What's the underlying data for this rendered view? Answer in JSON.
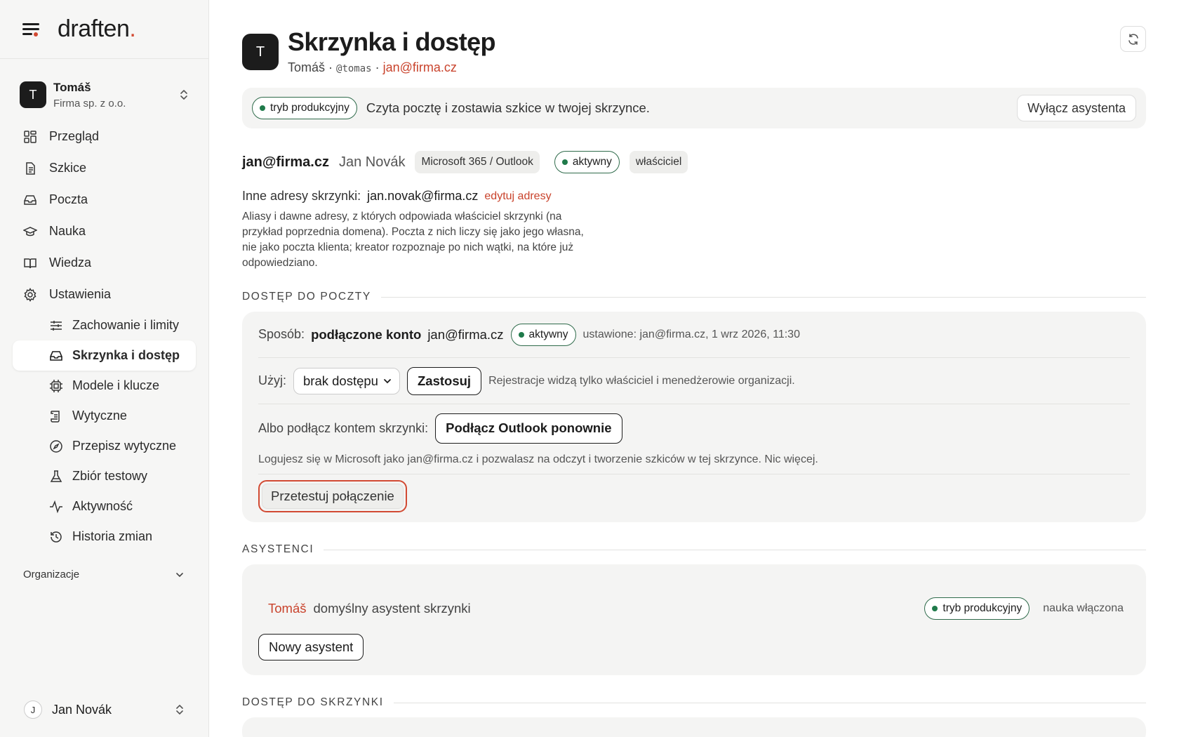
{
  "brand": {
    "logo_text": "draften",
    "logo_accent": "."
  },
  "org_switcher": {
    "initial": "T",
    "name": "Tomáš",
    "company": "Firma sp. z o.o."
  },
  "nav": {
    "items": [
      {
        "label": "Przegląd",
        "icon": "grid-icon"
      },
      {
        "label": "Szkice",
        "icon": "document-icon"
      },
      {
        "label": "Poczta",
        "icon": "inbox-icon"
      },
      {
        "label": "Nauka",
        "icon": "graduation-cap-icon"
      },
      {
        "label": "Wiedza",
        "icon": "book-icon"
      },
      {
        "label": "Ustawienia",
        "icon": "gear-icon"
      }
    ],
    "settings_sub": [
      {
        "label": "Zachowanie i limity",
        "icon": "sliders-icon"
      },
      {
        "label": "Skrzynka i dostęp",
        "icon": "inbox-icon",
        "active": true
      },
      {
        "label": "Modele i klucze",
        "icon": "chip-icon"
      },
      {
        "label": "Wytyczne",
        "icon": "scroll-icon"
      },
      {
        "label": "Przepisz wytyczne",
        "icon": "compass-icon"
      },
      {
        "label": "Zbiór testowy",
        "icon": "flask-icon"
      },
      {
        "label": "Aktywność",
        "icon": "activity-icon"
      },
      {
        "label": "Historia zmian",
        "icon": "history-icon"
      }
    ]
  },
  "org_section": {
    "label": "Organizacje"
  },
  "user": {
    "initial": "J",
    "name": "Jan Novák"
  },
  "header": {
    "initial": "T",
    "title": "Skrzynka i dostęp",
    "owner": "Tomáš",
    "sep1": " · ",
    "handle": "@tomas",
    "sep2": " · ",
    "email": "jan@firma.cz"
  },
  "banner": {
    "mode": "tryb produkcyjny",
    "description": "Czyta pocztę i zostawia szkice w twojej skrzynce.",
    "disable_button": "Wyłącz asystenta"
  },
  "account": {
    "email": "jan@firma.cz",
    "name": "Jan Novák",
    "provider": "Microsoft 365 / Outlook",
    "status": "aktywny",
    "role": "właściciel",
    "alias_label": "Inne adresy skrzynki:",
    "alias_value": "jan.novak@firma.cz",
    "alias_edit": "edytuj adresy",
    "alias_note": "Aliasy i dawne adresy, z których odpowiada właściciel skrzynki (na przykład poprzednia domena). Poczta z nich liczy się jako jego własna, nie jako poczta klienta; kreator rozpoznaje po nich wątki, na które już odpowiedziano."
  },
  "mail_access": {
    "section_title": "DOSTĘP DO POCZTY",
    "method_label": "Sposób:",
    "method_value": "podłączone konto",
    "method_email": "jan@firma.cz",
    "method_status": "aktywny",
    "set_info": "ustawione: jan@firma.cz, 1 wrz 2026, 11:30",
    "use_label": "Użyj:",
    "use_selected": "brak dostępu",
    "apply_button": "Zastosuj",
    "use_note": "Rejestracje widzą tylko właściciel i menedżerowie organizacji.",
    "connect_label": "Albo podłącz kontem skrzynki:",
    "connect_button": "Podłącz Outlook ponownie",
    "connect_note": "Logujesz się w Microsoft jako jan@firma.cz i pozwalasz na odczyt i tworzenie szkiców w tej skrzynce. Nic więcej.",
    "test_button": "Przetestuj połączenie"
  },
  "assistants": {
    "section_title": "ASYSTENCI",
    "name": "Tomáš",
    "description": "domyślny asystent skrzynki",
    "mode": "tryb produkcyjny",
    "learning": "nauka włączona",
    "new_button": "Nowy asystent"
  },
  "mailbox_access": {
    "section_title": "DOSTĘP DO SKRZYNKI"
  },
  "colors": {
    "accent": "#d24a33",
    "status_green": "#1f7a4a",
    "card_bg": "#f4f4f3"
  }
}
